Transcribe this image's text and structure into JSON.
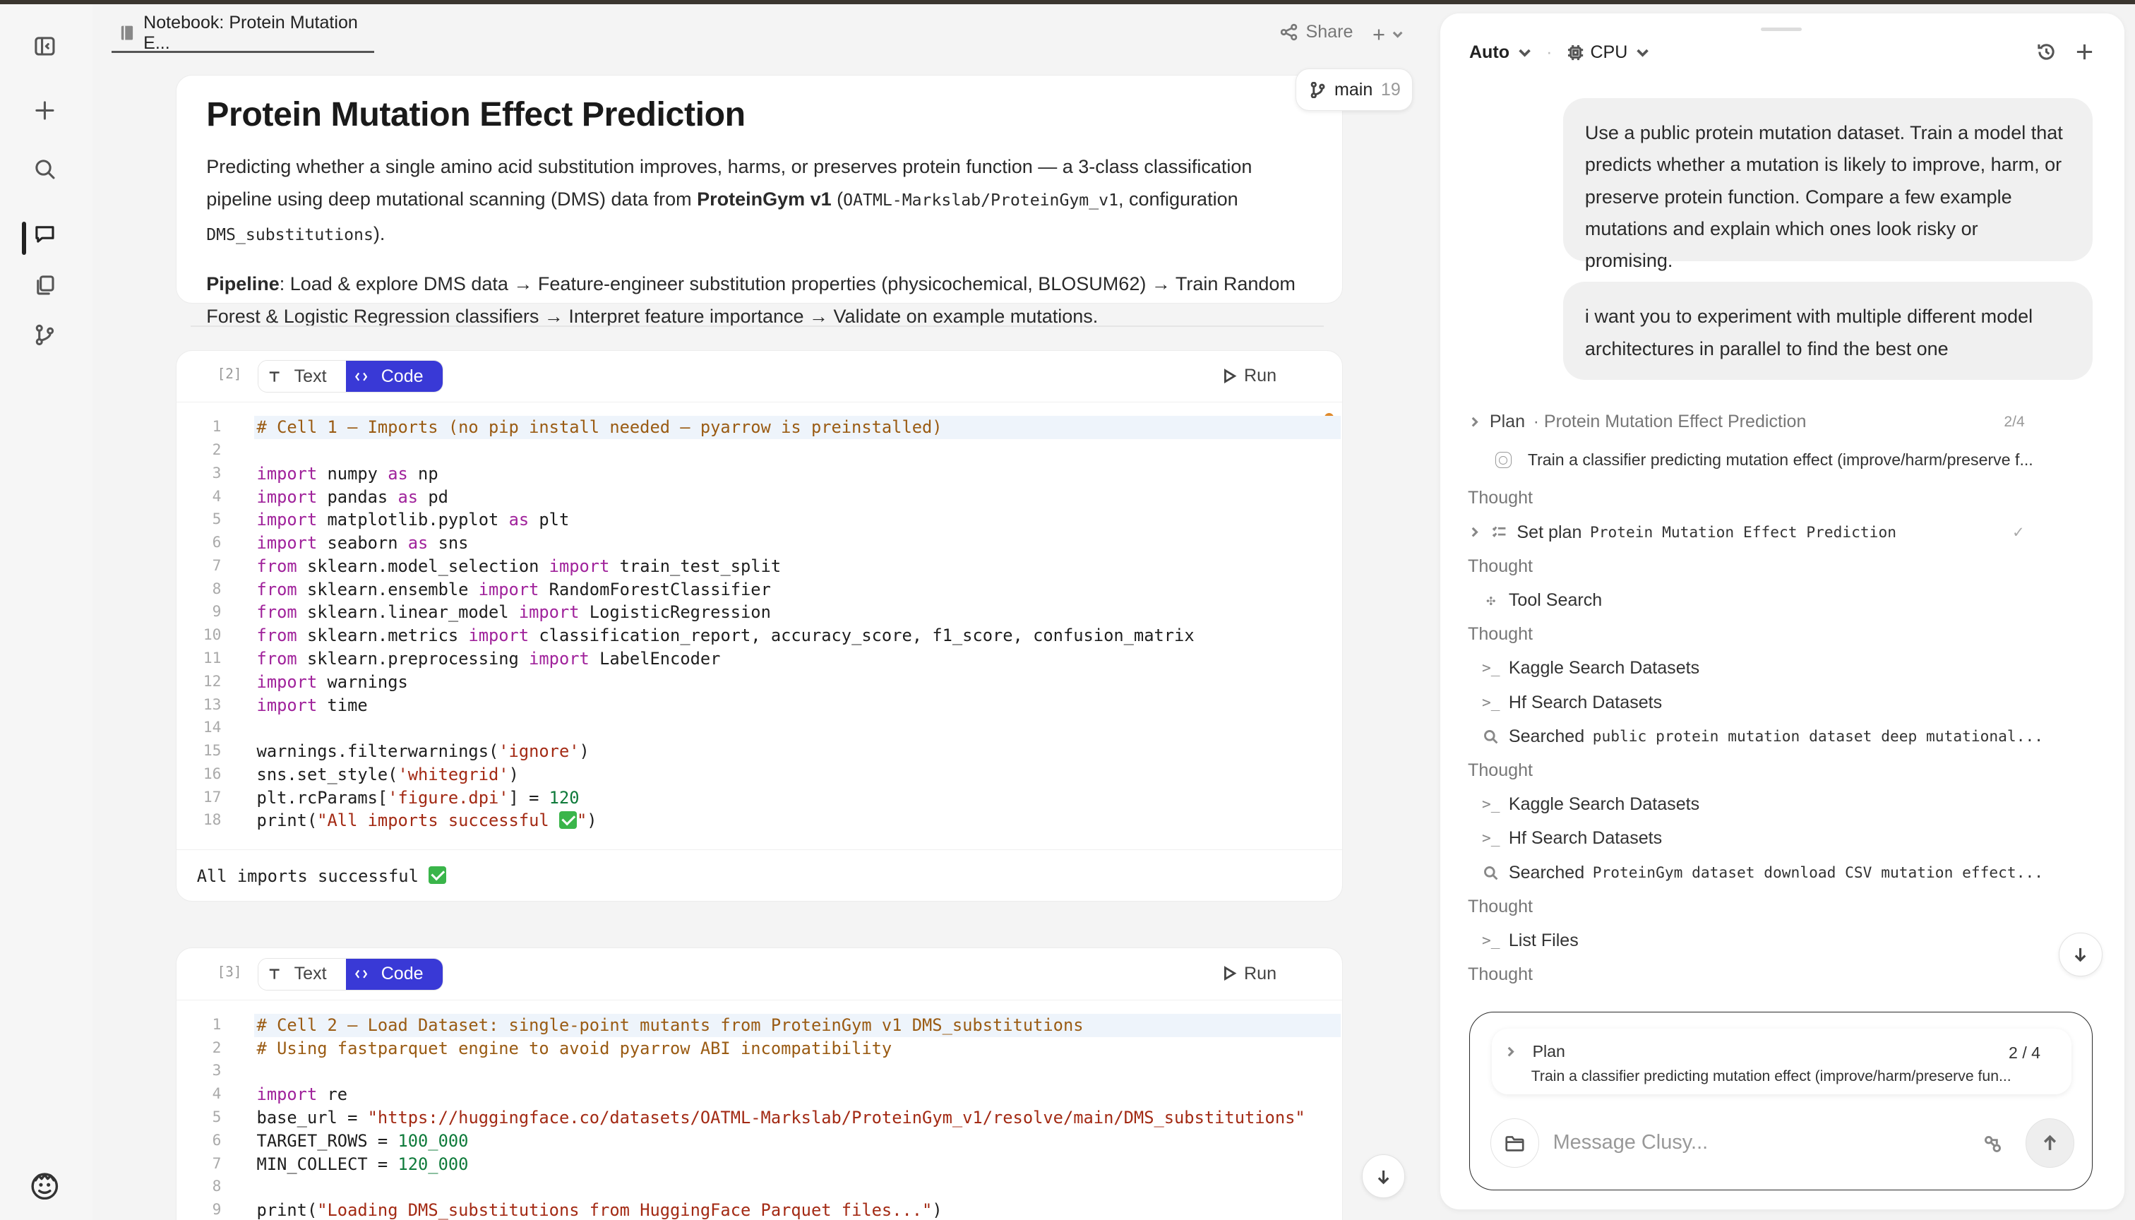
{
  "notebook": {
    "tab_label": "Notebook: Protein Mutation E...",
    "share_label": "Share",
    "plus_label": "+",
    "branch_name": "main",
    "branch_count": "19",
    "title": "Protein Mutation Effect Prediction",
    "intro_1": "Predicting whether a single amino acid substitution improves, harms, or preserves protein function — a 3-class classification pipeline using deep mutational scanning (DMS) data from ",
    "intro_bold": "ProteinGym v1",
    "intro_2": " (",
    "intro_code_1": "OATML-Markslab/ProteinGym_v1",
    "intro_3": ", configuration ",
    "intro_code_2": "DMS_substitutions",
    "intro_4": ").",
    "pipeline_label": "Pipeline",
    "pipeline_text": ": Load & explore DMS data → Feature-engineer substitution properties (physicochemical, BLOSUM62) → Train Random Forest & Logistic Regression classifiers → Interpret feature importance → Validate on example mutations.",
    "cells": [
      {
        "number": "[2]",
        "text_label": "Text",
        "code_label": "Code",
        "run_label": "Run",
        "output": "All imports successful"
      },
      {
        "number": "[3]",
        "text_label": "Text",
        "code_label": "Code",
        "run_label": "Run"
      }
    ]
  },
  "panel": {
    "mode": "Auto",
    "compute": "CPU",
    "user_message_1": "Use a public protein mutation dataset. Train a model that predicts whether a mutation is likely to improve, harm, or preserve protein function. Compare a few example mutations and explain which ones look risky or promising.",
    "user_message_2": "i want you to experiment with multiple different model architectures in parallel to find the best one",
    "feed": {
      "plan_label": "Plan",
      "plan_sub": "· Protein Mutation Effect Prediction",
      "plan_progress": "2/4",
      "plan_task": "Train a classifier predicting mutation effect (improve/harm/preserve f...",
      "thought": "Thought",
      "set_plan": "Set plan",
      "set_plan_arg": "Protein Mutation Effect Prediction",
      "tool_search": "Tool Search",
      "kaggle": "Kaggle Search Datasets",
      "hf": "Hf Search Datasets",
      "searched": "Searched",
      "search_1": "public protein mutation dataset deep mutational...",
      "search_2": "ProteinGym dataset download CSV mutation effect...",
      "list_files": "List Files"
    },
    "composer": {
      "plan_label": "Plan",
      "plan_progress": "2 / 4",
      "plan_task": "Train a classifier predicting mutation effect (improve/harm/preserve fun...",
      "placeholder": "Message Clusy..."
    }
  }
}
